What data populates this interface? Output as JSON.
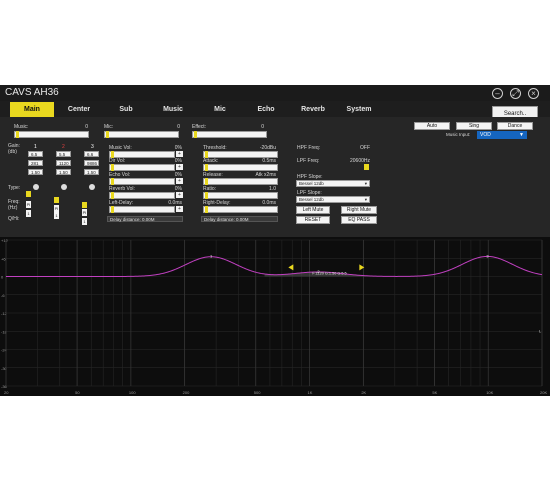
{
  "window": {
    "title": "CAVS AH36"
  },
  "tabs": [
    "Main",
    "Center",
    "Sub",
    "Music",
    "Mic",
    "Echo",
    "Reverb",
    "System"
  ],
  "search_label": "Search..",
  "left": {
    "music_label": "Music:",
    "music_value": "0",
    "mic_label": "Mic:",
    "mic_value": "0",
    "effect_label": "Effect:",
    "effect_value": "0",
    "gain_label": "Gain: (db)",
    "channels": [
      "1",
      "2",
      "3"
    ],
    "gains": [
      "6.5",
      "5.5",
      "6.6"
    ],
    "freqs": [
      "281",
      "1120",
      "9886"
    ],
    "qs": [
      "1.50",
      "1.50",
      "1.50"
    ],
    "type_label": "Type:",
    "freq_label": "Freq: (Hz)",
    "q_label": "Q/Hi:",
    "small_boxes": [
      "PI",
      "PI",
      "PI"
    ],
    "small_vals": [
      "1",
      "1",
      "1"
    ]
  },
  "mid": {
    "music_vol_label": "Music Vol:",
    "music_vol": "0%",
    "dir_vol_label": "Dir Vol:",
    "dir_vol": "0%",
    "echo_vol_label": "Echo Vol:",
    "echo_vol": "0%",
    "reverb_vol_label": "Reverb Vol:",
    "reverb_vol": "0%",
    "left_delay_label": "Left-Delay:",
    "left_delay": "0.0ms",
    "delay_distance": "Delay distance: 0.00M"
  },
  "right": {
    "threshold_label": "Threshold:",
    "threshold": "-20dBu",
    "attack_label": "Attack:",
    "attack": "0.5ms",
    "release_label": "Release:",
    "release": "Atk x2ms",
    "ratio_label": "Ratio:",
    "ratio": "1.0",
    "right_delay_label": "Right-Delay:",
    "right_delay": "0.0ms",
    "delay_distance": "Delay distance: 0.00M"
  },
  "filters": {
    "hpf_freq_label": "HPF Freq:",
    "hpf_freq": "OFF",
    "lpf_freq_label": "LPF Freq:",
    "lpf_freq": "20600Hz",
    "hpf_slope_label": "HPF Slope:",
    "hpf_slope": "Bessel 12db",
    "lpf_slope_label": "LPF Slope:",
    "lpf_slope": "Bessel 12db",
    "left_mute": "Left Mute",
    "right_mute": "Right Mute",
    "reset": "RESET",
    "eq_pass": "EQ PASS"
  },
  "mode": {
    "buttons": [
      "Auto",
      "Sing",
      "Dance"
    ],
    "music_input_label": "Music Input:",
    "music_input": "VOD"
  },
  "graph": {
    "y_ticks": [
      "+12",
      "+6",
      "0",
      "-6",
      "-12",
      "-18",
      "-24",
      "-30",
      "-36"
    ],
    "x_ticks": [
      "20",
      "50",
      "100",
      "200",
      "500",
      "1K",
      "2K",
      "5K",
      "10K",
      "20K"
    ],
    "marker_label": "F:1120 G:1.50 G:5.5",
    "point_labels": [
      "1",
      "2",
      "3"
    ],
    "right_marker": "L",
    "curve_color": "#c040c0"
  }
}
